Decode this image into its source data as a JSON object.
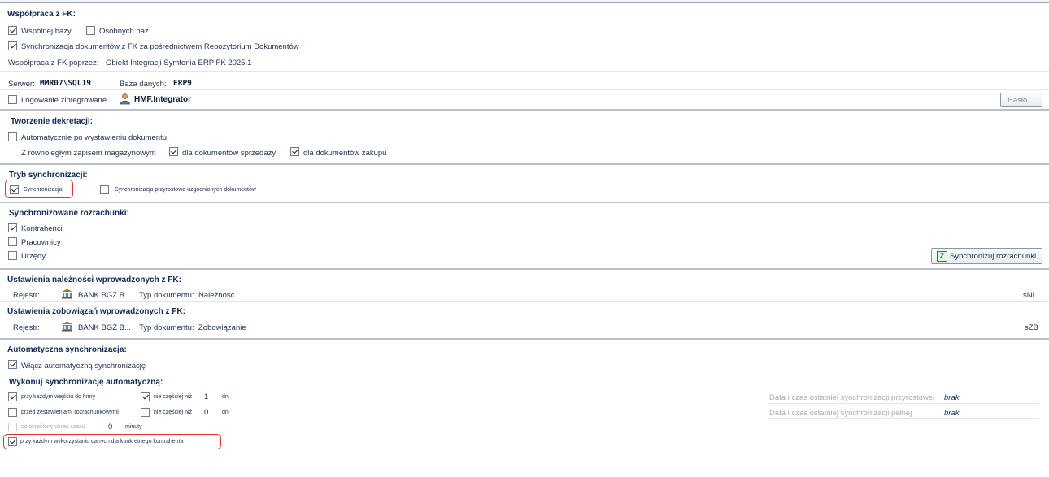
{
  "fk": {
    "header": "Współpraca z FK:",
    "shared_db": "Wspólnej bazy",
    "separate_db": "Osobnych baz",
    "sync_docs": "Synchronizacja dokumentów z FK za pośrednictwem Repozytorium Dokumentów",
    "via_label": "Współpraca z FK poprzez:",
    "via_value": "Obiekt Integracji Symfonia ERP FK 2025.1",
    "server_label": "Serwer:",
    "server_value": "MMR07\\SQL19",
    "db_label": "Baza danych:",
    "db_value": "ERP9",
    "integrated_login": "Logowanie zintegrowane",
    "user": "HMF.Integrator",
    "password_button": "Hasło ..."
  },
  "decree": {
    "header": "Tworzenie dekretacji:",
    "auto": "Automatycznie po wystawieniu dokumentu",
    "parallel": "Z równoległym zapisem magazynowym",
    "sales": "dla dokumentów sprzedaży",
    "purchase": "dla dokumentów zakupu"
  },
  "sync_mode": {
    "header": "Tryb synchronizacji:",
    "sync": "Synchronizacja",
    "incremental": "Synchronizacja przyrostowa uzgodnionych dokumentów"
  },
  "settlements": {
    "header": "Synchronizowane rozrachunki:",
    "contractors": "Kontrahenci",
    "employees": "Pracownicy",
    "offices": "Urzędy",
    "sync_button": "Synchronizuj rozrachunki"
  },
  "receivables": {
    "header": "Ustawienia należności wprowadzonych z FK:",
    "register_label": "Rejestr:",
    "register_value": "BANK BGŻ B...",
    "doctype_label": "Typ dokumentu:",
    "doctype_value": "Należność",
    "code": "sNL"
  },
  "liabilities": {
    "header": "Ustawienia zobowiązań wprowadzonych z FK:",
    "register_label": "Rejestr:",
    "register_value": "BANK BGŻ B...",
    "doctype_label": "Typ dokumentu:",
    "doctype_value": "Zobowiązanie",
    "code": "sZB"
  },
  "autosync": {
    "header": "Automatyczna synchronizacja:",
    "enable": "Włącz automatyczną synchronizację",
    "sub_header": "Wykonuj synchronizację automatyczną:",
    "on_enter": "przy każdym wejściu do firmy",
    "not_often1": "nie częściej niż",
    "days1": "1",
    "days_unit1": "dni",
    "before_settle": "przed zestawieniami rozrachunkowymi",
    "not_often2": "nie częściej niż",
    "days2": "0",
    "days_unit2": "dni",
    "period": "co określony okres czasu",
    "period_value": "0",
    "period_unit": "minuty",
    "per_contractor": "przy każdym wykorzystaniu danych dla konkretnego kontrahenta",
    "last_incremental_label": "Data i czas ostatniej synchronizacji przyrostowej",
    "last_incremental_value": "brak",
    "last_full_label": "Data i czas ostatniej synchronizacji pełnej",
    "last_full_value": "brak"
  },
  "colors": {
    "accent_red": "#e23030",
    "header_blue": "#0f2a58"
  }
}
